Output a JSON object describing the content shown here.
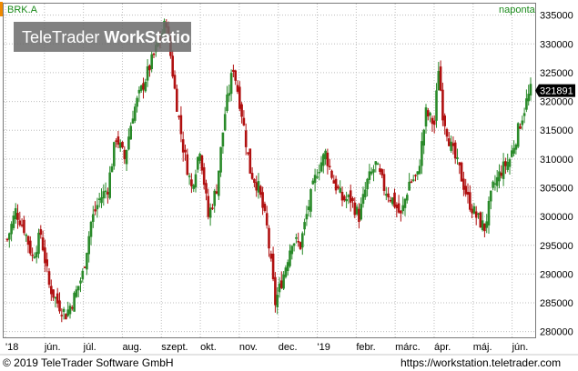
{
  "header": {
    "ticker": "BRK.A",
    "frequency": "naponta"
  },
  "watermark": {
    "prefix": "TeleTrader ",
    "bold": "WorkStation"
  },
  "footer": {
    "copyright": "© 2019 TeleTrader Software GmbH",
    "url": "https://workstation.teletrader.com"
  },
  "colors": {
    "up": "#2a8a2a",
    "down": "#b01010",
    "grid": "#bdbdbd",
    "accent": "#f08a00",
    "price_tag_bg": "#000000"
  },
  "chart_data": {
    "type": "candlestick",
    "x_ticks": [
      "'18",
      "jún.",
      "júl.",
      "aug.",
      "szept.",
      "okt.",
      "nov.",
      "dec.",
      "'19",
      "febr.",
      "márc.",
      "ápr.",
      "máj.",
      "jún."
    ],
    "y_ticks": [
      "280000",
      "285000",
      "290000",
      "295000",
      "300000",
      "305000",
      "310000",
      "315000",
      "320000",
      "325000",
      "330000",
      "335000"
    ],
    "ylim": [
      279000,
      337000
    ],
    "last_price": "321891",
    "grid": true,
    "close_path": [
      [
        0,
        296000
      ],
      [
        4,
        301000
      ],
      [
        8,
        298000
      ],
      [
        12,
        293000
      ],
      [
        16,
        297000
      ],
      [
        20,
        288000
      ],
      [
        24,
        285000
      ],
      [
        28,
        283000
      ],
      [
        32,
        286000
      ],
      [
        36,
        290000
      ],
      [
        40,
        299000
      ],
      [
        44,
        303000
      ],
      [
        48,
        305000
      ],
      [
        52,
        314000
      ],
      [
        56,
        310000
      ],
      [
        60,
        318000
      ],
      [
        64,
        322000
      ],
      [
        68,
        326000
      ],
      [
        72,
        330000
      ],
      [
        76,
        334000
      ],
      [
        80,
        322000
      ],
      [
        84,
        312000
      ],
      [
        88,
        305000
      ],
      [
        92,
        312000
      ],
      [
        96,
        300000
      ],
      [
        100,
        305000
      ],
      [
        104,
        318000
      ],
      [
        108,
        326000
      ],
      [
        112,
        318000
      ],
      [
        116,
        308000
      ],
      [
        120,
        305000
      ],
      [
        124,
        298000
      ],
      [
        128,
        285000
      ],
      [
        132,
        290000
      ],
      [
        136,
        296000
      ],
      [
        140,
        295000
      ],
      [
        144,
        302000
      ],
      [
        148,
        308000
      ],
      [
        152,
        311000
      ],
      [
        156,
        306000
      ],
      [
        160,
        303000
      ],
      [
        164,
        303000
      ],
      [
        168,
        300000
      ],
      [
        172,
        306000
      ],
      [
        176,
        309000
      ],
      [
        180,
        305000
      ],
      [
        184,
        303000
      ],
      [
        188,
        300000
      ],
      [
        192,
        306000
      ],
      [
        196,
        307000
      ],
      [
        200,
        318000
      ],
      [
        204,
        316000
      ],
      [
        206,
        326000
      ],
      [
        208,
        318000
      ],
      [
        212,
        312000
      ],
      [
        216,
        308000
      ],
      [
        220,
        303000
      ],
      [
        224,
        300000
      ],
      [
        228,
        298000
      ],
      [
        232,
        305000
      ],
      [
        236,
        308000
      ],
      [
        240,
        310000
      ],
      [
        244,
        315000
      ],
      [
        248,
        320000
      ],
      [
        250,
        321891
      ]
    ]
  }
}
